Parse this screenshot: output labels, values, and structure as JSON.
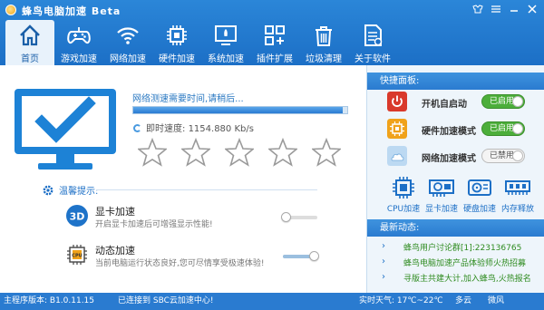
{
  "window": {
    "title": "蜂鸟电脑加速 Beta"
  },
  "nav": [
    {
      "label": "首页",
      "icon": "home-icon"
    },
    {
      "label": "游戏加速",
      "icon": "gamepad-icon"
    },
    {
      "label": "网络加速",
      "icon": "wifi-icon"
    },
    {
      "label": "硬件加速",
      "icon": "chip-icon"
    },
    {
      "label": "系统加速",
      "icon": "rocket-monitor-icon"
    },
    {
      "label": "插件扩展",
      "icon": "grid-icon"
    },
    {
      "label": "垃圾清理",
      "icon": "trash-icon"
    },
    {
      "label": "关于软件",
      "icon": "document-icon"
    }
  ],
  "main": {
    "status_text": "网络测速需要时间,请稍后...",
    "progress": 0.98,
    "speed_label": "即时速度:",
    "speed_value": "1154.880 Kb/s",
    "rating": 0,
    "tips_title": "温馨提示:",
    "tips": [
      {
        "title": "显卡加速",
        "desc": "开启显卡加速后可增强显示性能!",
        "icon": "3d-icon",
        "enabled": false
      },
      {
        "title": "动态加速",
        "desc": "当前电脑运行状态良好,您可尽情享受极速体验!",
        "icon": "cpu-icon",
        "enabled": true
      }
    ]
  },
  "panel": {
    "quick_title": "快捷面板:",
    "toggles": [
      {
        "label": "开机自启动",
        "state": "已启用",
        "on": true,
        "icon": "power-icon",
        "color": "#d9392b"
      },
      {
        "label": "硬件加速模式",
        "state": "已启用",
        "on": true,
        "icon": "chip-icon",
        "color": "#f0a21a"
      },
      {
        "label": "网络加速模式",
        "state": "已禁用",
        "on": false,
        "icon": "cloud-icon",
        "color": "#bcd9f2"
      }
    ],
    "tools": [
      {
        "label": "CPU加速",
        "icon": "cpu-icon"
      },
      {
        "label": "显卡加速",
        "icon": "gpu-icon"
      },
      {
        "label": "硬盘加速",
        "icon": "hdd-icon"
      },
      {
        "label": "内存释放",
        "icon": "ram-icon"
      }
    ],
    "news_title": "最新动态:",
    "news": [
      "蜂鸟用户讨论群[1]:223136765",
      "蜂鸟电脑加速产品体验师火热招募",
      "寻版主共建大计,加入蜂鸟,火热报名"
    ]
  },
  "statusbar": {
    "version": "主程序版本: B1.0.11.15",
    "connection": "已连接到 SBC云加速中心!",
    "weather_label": "实时天气: 17℃~22℃",
    "weather": "多云",
    "wind": "微风"
  },
  "colors": {
    "brand": "#2a7bd0",
    "accent": "#1c6fc6",
    "on": "#4cae3a",
    "news": "#2e8b1f"
  }
}
